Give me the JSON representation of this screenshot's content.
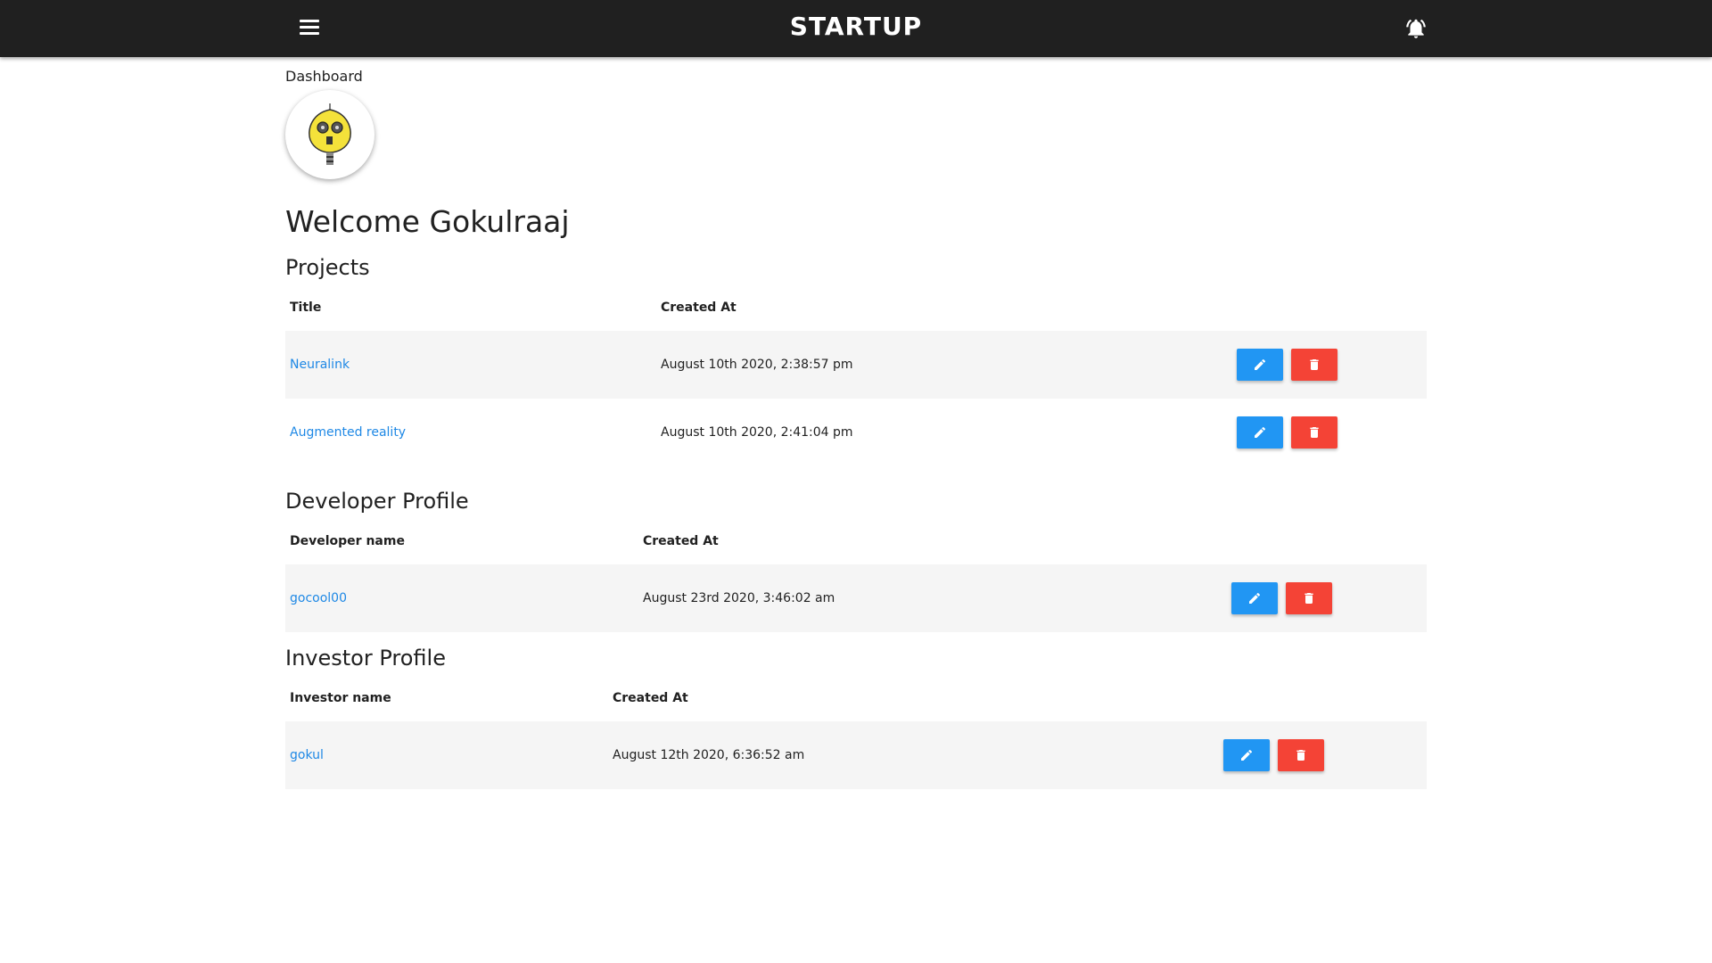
{
  "app": {
    "brand": "STARTUP",
    "menu_icon": "menu-icon",
    "bell_icon": "bell-icon"
  },
  "breadcrumb": "Dashboard",
  "welcome": "Welcome Gokulraaj",
  "colors": {
    "navbar": "#202020",
    "link": "#1e88e5",
    "edit": "#2196f3",
    "delete": "#f44336"
  },
  "projects": {
    "heading": "Projects",
    "columns": [
      "Title",
      "Created At"
    ],
    "rows": [
      {
        "title": "Neuralink",
        "created": "August 10th 2020, 2:38:57 pm"
      },
      {
        "title": "Augmented reality",
        "created": "August 10th 2020, 2:41:04 pm"
      }
    ]
  },
  "developer": {
    "heading": "Developer Profile",
    "columns": [
      "Developer name",
      "Created At"
    ],
    "rows": [
      {
        "name": "gocool00",
        "created": "August 23rd 2020, 3:46:02 am"
      }
    ]
  },
  "investor": {
    "heading": "Investor Profile",
    "columns": [
      "Investor name",
      "Created At"
    ],
    "rows": [
      {
        "name": "gokul",
        "created": "August 12th 2020, 6:36:52 am"
      }
    ]
  }
}
